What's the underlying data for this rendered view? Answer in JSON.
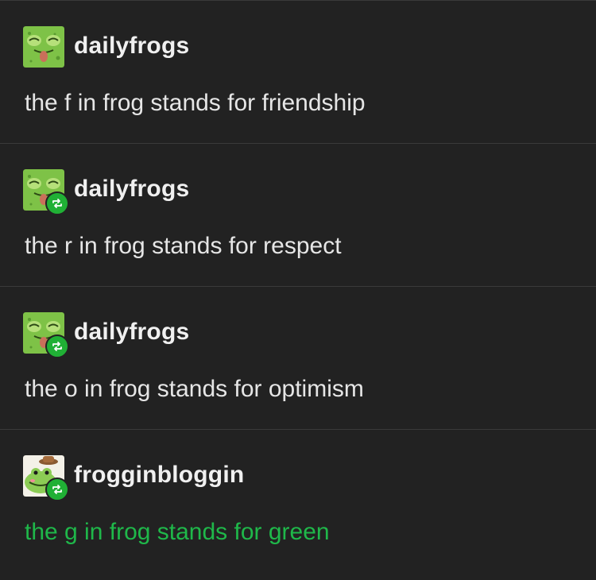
{
  "posts": [
    {
      "username": "dailyfrogs",
      "text": "the f in frog stands for friendship",
      "avatar": "frog-avatar-icon",
      "reblogged": false,
      "text_color": "#e6e6e6"
    },
    {
      "username": "dailyfrogs",
      "text": "the r in frog stands for respect",
      "avatar": "frog-avatar-icon",
      "reblogged": true,
      "text_color": "#e6e6e6"
    },
    {
      "username": "dailyfrogs",
      "text": "the o in frog stands for optimism",
      "avatar": "frog-avatar-icon",
      "reblogged": true,
      "text_color": "#e6e6e6"
    },
    {
      "username": "frogginbloggin",
      "text": "the g in frog stands for green",
      "avatar": "cowboy-frog-avatar-icon",
      "reblogged": true,
      "text_color": "#1fb84a"
    }
  ],
  "colors": {
    "background": "#222222",
    "divider": "#3a3a3a",
    "reblog_badge": "#20b035",
    "accent_green": "#1fb84a"
  }
}
